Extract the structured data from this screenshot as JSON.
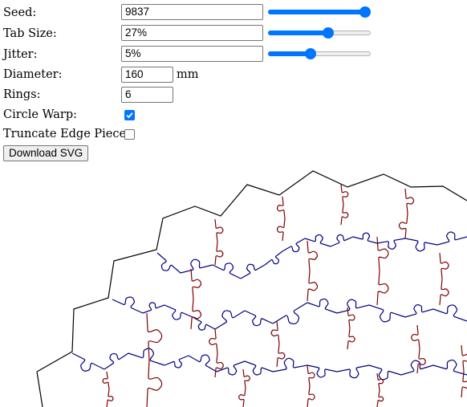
{
  "controls": {
    "seed": {
      "label": "Seed:",
      "value": "9837",
      "slider_fraction": 1.0
    },
    "tab_size": {
      "label": "Tab Size:",
      "value": "27%",
      "slider_fraction": 0.6
    },
    "jitter": {
      "label": "Jitter:",
      "value": "5%",
      "slider_fraction": 0.4
    },
    "diameter": {
      "label": "Diameter:",
      "value": "160",
      "unit": "mm"
    },
    "rings": {
      "label": "Rings:",
      "value": "6"
    },
    "circle_warp": {
      "label": "Circle Warp:",
      "checked": true
    },
    "truncate_edge": {
      "label": "Truncate Edge Pieces:",
      "checked": false
    },
    "download_label": "Download SVG"
  },
  "colors": {
    "accent": "#0075ff",
    "outline": "#000000",
    "horizontal_cuts": "#000080",
    "vertical_cuts": "#800000"
  }
}
